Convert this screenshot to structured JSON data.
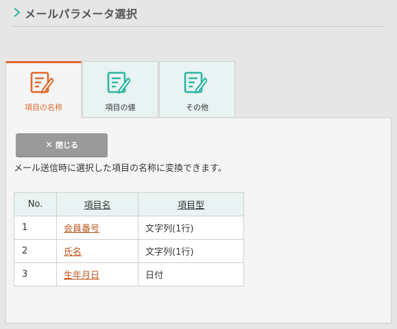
{
  "header": {
    "title": "メールパラメータ選択"
  },
  "colors": {
    "accent": "#e0672a",
    "teal": "#2bb5a0",
    "link": "#c0541c",
    "button_bg": "#9a9a9a"
  },
  "tabs": [
    {
      "label": "項目の名称",
      "icon": "edit-note-icon",
      "active": true
    },
    {
      "label": "項目の値",
      "icon": "edit-note-icon",
      "active": false
    },
    {
      "label": "その他",
      "icon": "edit-note-icon",
      "active": false
    }
  ],
  "panel": {
    "close_button": {
      "icon": "close-icon",
      "label": "閉じる"
    },
    "description": "メール送信時に選択した項目の名称に変換できます。",
    "table": {
      "headers": [
        "No.",
        "項目名",
        "項目型"
      ],
      "rows": [
        {
          "no": "1",
          "name": "会員番号",
          "type": "文字列(1行)"
        },
        {
          "no": "2",
          "name": "氏名",
          "type": "文字列(1行)"
        },
        {
          "no": "3",
          "name": "生年月日",
          "type": "日付"
        }
      ]
    }
  }
}
